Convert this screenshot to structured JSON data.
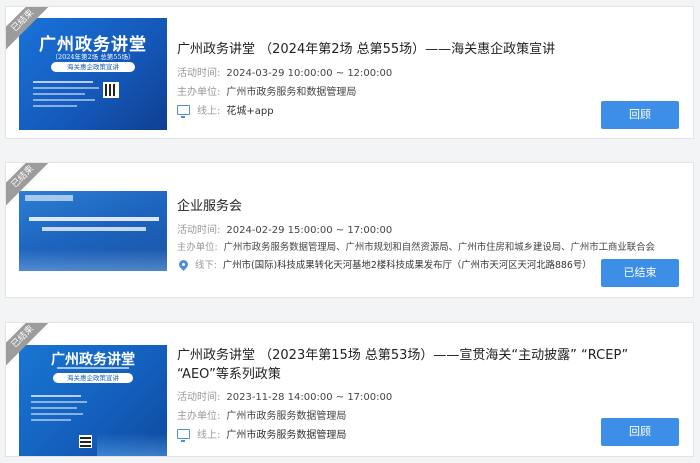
{
  "events": [
    {
      "status_ribbon": "已结束",
      "title": "广州政务讲堂 （2024年第2场 总第55场）——海关惠企政策宣讲",
      "time_label": "活动时间:",
      "time_value": "2024-03-29 10:00:00 ~ 12:00:00",
      "host_label": "主办单位:",
      "host_value": "广州市政务服务和数据管理局",
      "venue_icon": "monitor-icon",
      "venue_label": "线上:",
      "venue_value": "花城+app",
      "button_label": "回顾",
      "poster": {
        "title": "广州政务讲堂",
        "subtitle": "（2024年第2场 总第55场）",
        "banner": "海关惠企政策宣讲"
      }
    },
    {
      "status_ribbon": "已结束",
      "title": "企业服务会",
      "time_label": "活动时间:",
      "time_value": "2024-02-29 15:00:00 ~ 17:00:00",
      "host_label": "主办单位:",
      "host_value": "广州市政务服务数据管理局、广州市规划和自然资源局、广州市住房和城乡建设局、广州市工商业联合会",
      "venue_icon": "location-pin-icon",
      "venue_label": "线下:",
      "venue_value": "广州市(国际)科技成果转化天河基地2楼科技成果发布厅（广州市天河区天河北路886号）",
      "button_label": "已结束",
      "poster": {
        "title": "",
        "subtitle": "",
        "banner": ""
      }
    },
    {
      "status_ribbon": "已结束",
      "title": "广州政务讲堂 （2023年第15场 总第53场）——宣贯海关“主动披露” “RCEP” “AEO”等系列政策",
      "time_label": "活动时间:",
      "time_value": "2023-11-28 14:00:00 ~ 17:00:00",
      "host_label": "主办单位:",
      "host_value": "广州市政务服务数据管理局",
      "venue_icon": "monitor-icon",
      "venue_label": "线上:",
      "venue_value": "广州市政务服务数据管理局",
      "button_label": "回顾",
      "poster": {
        "title": "广州政务讲堂",
        "subtitle": "",
        "banner": "海关惠企政策宣讲"
      }
    }
  ],
  "colors": {
    "accent": "#3d8ee6",
    "ribbon": "#9c9c9c",
    "poster_bg": "#1565c0"
  }
}
